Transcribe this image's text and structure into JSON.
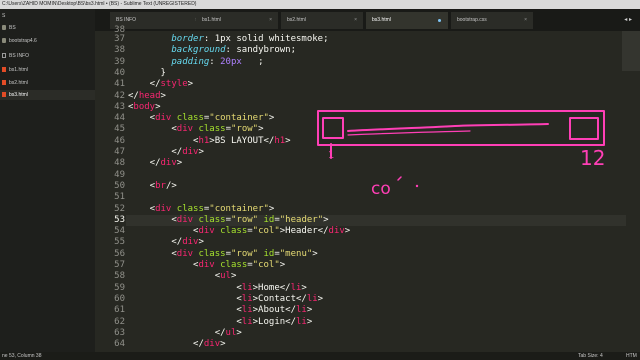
{
  "window": {
    "title": "C:\\Users\\ZAHID MOMIN\\Desktop\\BS\\bs3.html • (BS) - Sublime Text (UNREGISTERED)"
  },
  "sidebar": {
    "items": [
      {
        "label": "S",
        "icon": "folder-icon"
      },
      {
        "label": "BS",
        "icon": "folder-icon"
      },
      {
        "label": "bootstrap4.6",
        "icon": "folder-icon"
      },
      {
        "label": "BS INFO",
        "icon": "file-icon"
      },
      {
        "label": "bs1.html",
        "icon": "html-file-icon"
      },
      {
        "label": "bs2.html",
        "icon": "html-file-icon"
      },
      {
        "label": "bs3.html",
        "icon": "html-file-icon",
        "active": true
      }
    ]
  },
  "tabs": [
    {
      "label": "BS INFO",
      "close": "×"
    },
    {
      "label": "bs1.html",
      "close": "×"
    },
    {
      "label": "bs2.html",
      "close": "×"
    },
    {
      "label": "bs3.html",
      "active": true,
      "modified": true
    },
    {
      "label": "bootstrap.css",
      "close": "×"
    }
  ],
  "tab_nav": "◂ ▸",
  "editor": {
    "first_line_partial": "38",
    "current_line": 53,
    "lines": [
      {
        "n": "37",
        "tokens": [
          [
            "t",
            "        "
          ],
          [
            "prop",
            "border"
          ],
          [
            "p",
            ": "
          ],
          [
            "t",
            "1px solid whitesmoke"
          ],
          [
            "p",
            ";"
          ]
        ]
      },
      {
        "n": "38",
        "tokens": [
          [
            "t",
            "        "
          ],
          [
            "prop",
            "background"
          ],
          [
            "p",
            ": "
          ],
          [
            "t",
            "sandybrown"
          ],
          [
            "p",
            ";"
          ]
        ]
      },
      {
        "n": "39",
        "tokens": [
          [
            "t",
            "        "
          ],
          [
            "prop",
            "padding"
          ],
          [
            "p",
            ": "
          ],
          [
            "num",
            "20px"
          ],
          [
            "p",
            "   ;"
          ]
        ]
      },
      {
        "n": "40",
        "tokens": [
          [
            "t",
            "      }"
          ]
        ]
      },
      {
        "n": "41",
        "tokens": [
          [
            "t",
            "    </"
          ],
          [
            "tag",
            "style"
          ],
          [
            "t",
            ">"
          ]
        ]
      },
      {
        "n": "42",
        "tokens": [
          [
            "t",
            "</"
          ],
          [
            "tag",
            "head"
          ],
          [
            "t",
            ">"
          ]
        ]
      },
      {
        "n": "43",
        "tokens": [
          [
            "t",
            "<"
          ],
          [
            "tag",
            "body"
          ],
          [
            "t",
            ">"
          ]
        ]
      },
      {
        "n": "44",
        "tokens": [
          [
            "t",
            "    <"
          ],
          [
            "tag",
            "div"
          ],
          [
            "t",
            " "
          ],
          [
            "attr",
            "class"
          ],
          [
            "t",
            "="
          ],
          [
            "str",
            "\"container\""
          ],
          [
            "t",
            ">"
          ]
        ]
      },
      {
        "n": "45",
        "tokens": [
          [
            "t",
            "        <"
          ],
          [
            "tag",
            "div"
          ],
          [
            "t",
            " "
          ],
          [
            "attr",
            "class"
          ],
          [
            "t",
            "="
          ],
          [
            "str",
            "\"row\""
          ],
          [
            "t",
            ">"
          ]
        ]
      },
      {
        "n": "46",
        "tokens": [
          [
            "t",
            "            <"
          ],
          [
            "tag",
            "h1"
          ],
          [
            "t",
            ">BS LAYOUT</"
          ],
          [
            "tag",
            "h1"
          ],
          [
            "t",
            ">"
          ]
        ]
      },
      {
        "n": "47",
        "tokens": [
          [
            "t",
            "        </"
          ],
          [
            "tag",
            "div"
          ],
          [
            "t",
            ">"
          ]
        ]
      },
      {
        "n": "48",
        "tokens": [
          [
            "t",
            "    </"
          ],
          [
            "tag",
            "div"
          ],
          [
            "t",
            ">"
          ]
        ]
      },
      {
        "n": "49",
        "tokens": [
          [
            "t",
            ""
          ]
        ]
      },
      {
        "n": "50",
        "tokens": [
          [
            "t",
            "    <"
          ],
          [
            "tag",
            "br"
          ],
          [
            "t",
            "/>"
          ]
        ]
      },
      {
        "n": "51",
        "tokens": [
          [
            "t",
            ""
          ]
        ]
      },
      {
        "n": "52",
        "tokens": [
          [
            "t",
            "    <"
          ],
          [
            "tag",
            "div"
          ],
          [
            "t",
            " "
          ],
          [
            "attr",
            "class"
          ],
          [
            "t",
            "="
          ],
          [
            "str",
            "\"container\""
          ],
          [
            "t",
            ">"
          ]
        ]
      },
      {
        "n": "53",
        "tokens": [
          [
            "t",
            "        <"
          ],
          [
            "tag",
            "div"
          ],
          [
            "t",
            " "
          ],
          [
            "attr",
            "class"
          ],
          [
            "t",
            "="
          ],
          [
            "str",
            "\"row\""
          ],
          [
            "t",
            " "
          ],
          [
            "attr",
            "id"
          ],
          [
            "t",
            "="
          ],
          [
            "str",
            "\"header\""
          ],
          [
            "t",
            ">"
          ]
        ]
      },
      {
        "n": "54",
        "tokens": [
          [
            "t",
            "            <"
          ],
          [
            "tag",
            "div"
          ],
          [
            "t",
            " "
          ],
          [
            "attr",
            "class"
          ],
          [
            "t",
            "="
          ],
          [
            "str",
            "\"col\""
          ],
          [
            "t",
            ">Header</"
          ],
          [
            "tag",
            "div"
          ],
          [
            "t",
            ">"
          ]
        ]
      },
      {
        "n": "55",
        "tokens": [
          [
            "t",
            "        </"
          ],
          [
            "tag",
            "div"
          ],
          [
            "t",
            ">"
          ]
        ]
      },
      {
        "n": "56",
        "tokens": [
          [
            "t",
            "        <"
          ],
          [
            "tag",
            "div"
          ],
          [
            "t",
            " "
          ],
          [
            "attr",
            "class"
          ],
          [
            "t",
            "="
          ],
          [
            "str",
            "\"row\""
          ],
          [
            "t",
            " "
          ],
          [
            "attr",
            "id"
          ],
          [
            "t",
            "="
          ],
          [
            "str",
            "\"menu\""
          ],
          [
            "t",
            ">"
          ]
        ]
      },
      {
        "n": "57",
        "tokens": [
          [
            "t",
            "            <"
          ],
          [
            "tag",
            "div"
          ],
          [
            "t",
            " "
          ],
          [
            "attr",
            "class"
          ],
          [
            "t",
            "="
          ],
          [
            "str",
            "\"col\""
          ],
          [
            "t",
            ">"
          ]
        ]
      },
      {
        "n": "58",
        "tokens": [
          [
            "t",
            "                <"
          ],
          [
            "tag",
            "ul"
          ],
          [
            "t",
            ">"
          ]
        ]
      },
      {
        "n": "59",
        "tokens": [
          [
            "t",
            "                    <"
          ],
          [
            "tag",
            "li"
          ],
          [
            "t",
            ">Home</"
          ],
          [
            "tag",
            "li"
          ],
          [
            "t",
            ">"
          ]
        ]
      },
      {
        "n": "60",
        "tokens": [
          [
            "t",
            "                    <"
          ],
          [
            "tag",
            "li"
          ],
          [
            "t",
            ">Contact</"
          ],
          [
            "tag",
            "li"
          ],
          [
            "t",
            ">"
          ]
        ]
      },
      {
        "n": "61",
        "tokens": [
          [
            "t",
            "                    <"
          ],
          [
            "tag",
            "li"
          ],
          [
            "t",
            ">About</"
          ],
          [
            "tag",
            "li"
          ],
          [
            "t",
            ">"
          ]
        ]
      },
      {
        "n": "62",
        "tokens": [
          [
            "t",
            "                    <"
          ],
          [
            "tag",
            "li"
          ],
          [
            "t",
            ">Login</"
          ],
          [
            "tag",
            "li"
          ],
          [
            "t",
            ">"
          ]
        ]
      },
      {
        "n": "63",
        "tokens": [
          [
            "t",
            "                </"
          ],
          [
            "tag",
            "ul"
          ],
          [
            "t",
            ">"
          ]
        ]
      },
      {
        "n": "64",
        "tokens": [
          [
            "t",
            "            </"
          ],
          [
            "tag",
            "div"
          ],
          [
            "t",
            ">"
          ]
        ]
      }
    ]
  },
  "annotation": {
    "color": "#ff3fb6",
    "left_label": "1",
    "right_label": "12",
    "scribble": "co"
  },
  "status": {
    "left": "ne 53, Column 38",
    "tab_size": "Tab Size: 4",
    "syntax": "HTM"
  },
  "colors": {
    "editor_bg": "#272822",
    "tag": "#f92672",
    "attr": "#a6e22e",
    "string": "#e6db74",
    "property": "#66d9ef",
    "number": "#ae81ff"
  }
}
